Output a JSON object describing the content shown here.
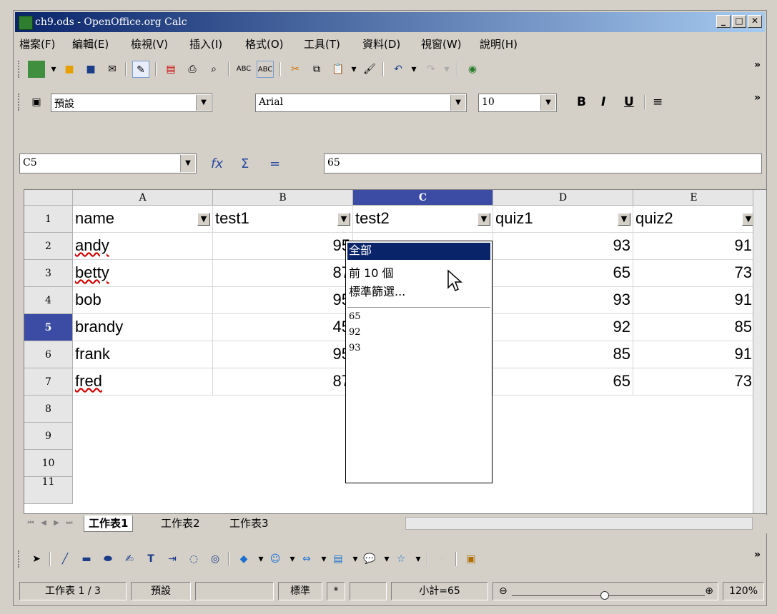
{
  "window": {
    "title": "ch9.ods - OpenOffice.org Calc"
  },
  "menu": [
    "檔案(F)",
    "編輯(E)",
    "檢視(V)",
    "插入(I)",
    "格式(O)",
    "工具(T)",
    "資料(D)",
    "視窗(W)",
    "說明(H)"
  ],
  "format_bar": {
    "style": "預設",
    "font": "Arial",
    "size": "10"
  },
  "formula_bar": {
    "cell_ref": "C5",
    "value": "65"
  },
  "columns": [
    "A",
    "B",
    "C",
    "D",
    "E"
  ],
  "rows": [
    "1",
    "2",
    "3",
    "4",
    "5",
    "6",
    "7",
    "8",
    "9",
    "10",
    "11"
  ],
  "header_cells": [
    "name",
    "test1",
    "test2",
    "quiz1",
    "quiz2"
  ],
  "data": [
    {
      "name": "andy",
      "test1": "95",
      "quiz1": "93",
      "quiz2": "91"
    },
    {
      "name": "betty",
      "test1": "87",
      "quiz1": "65",
      "quiz2": "73"
    },
    {
      "name": "bob",
      "test1": "95",
      "quiz1": "93",
      "quiz2": "91"
    },
    {
      "name": "brandy",
      "test1": "45",
      "quiz1": "92",
      "quiz2": "85"
    },
    {
      "name": "frank",
      "test1": "95",
      "quiz1": "85",
      "quiz2": "91"
    },
    {
      "name": "fred",
      "test1": "87",
      "quiz1": "65",
      "quiz2": "73"
    }
  ],
  "autofilter_dropdown": {
    "options": [
      "全部",
      "前 10 個",
      "標準篩選..."
    ],
    "values": [
      "65",
      "92",
      "93"
    ]
  },
  "sheet_tabs": [
    "工作表1",
    "工作表2",
    "工作表3"
  ],
  "status": {
    "sheet": "工作表 1 / 3",
    "page_style": "預設",
    "mode": "標準",
    "star": "*",
    "sum": "小計=65",
    "zoom": "120%"
  }
}
